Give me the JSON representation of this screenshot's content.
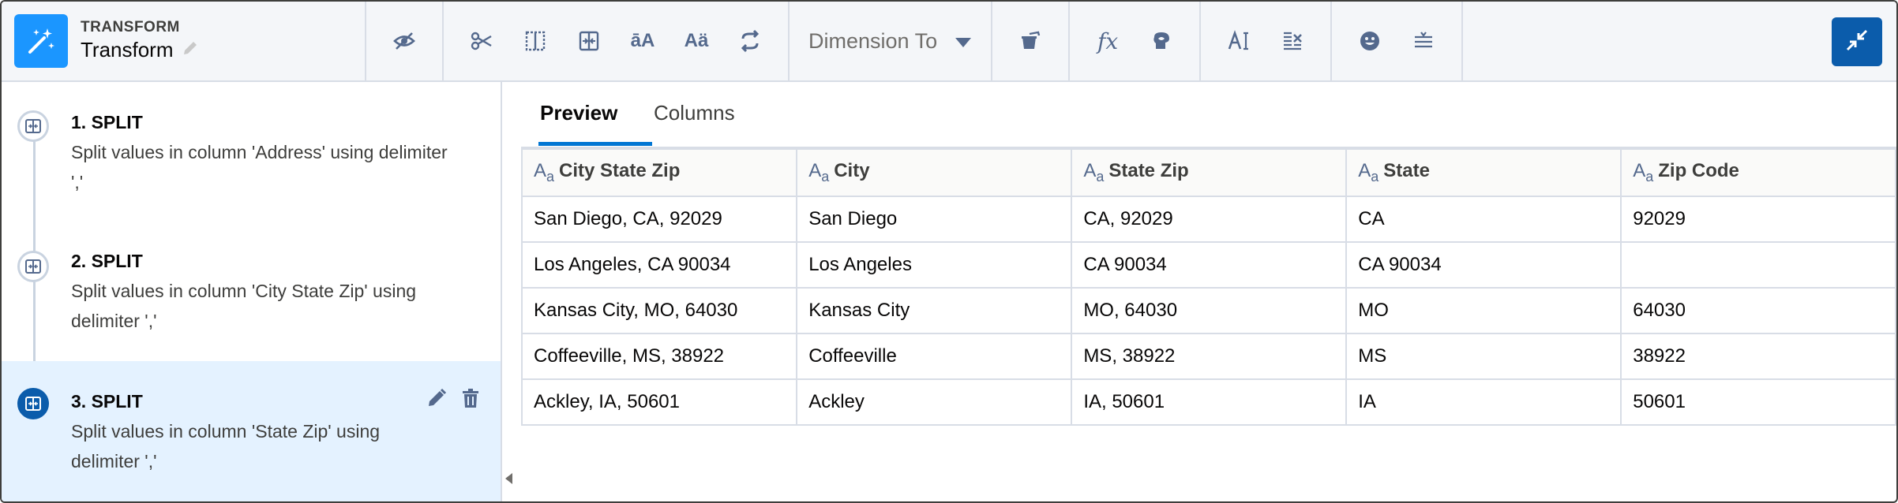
{
  "header": {
    "subtitle": "TRANSFORM",
    "title": "Transform"
  },
  "toolbar": {
    "dropdown_label": "Dimension To",
    "icons": [
      "hide-icon",
      "scissors-icon",
      "columns-icon",
      "split-icon",
      "case-icon",
      "accent-icon",
      "swap-icon",
      "dropdown-icon",
      "bucket-icon",
      "formula-icon",
      "predict-icon",
      "text-format-icon",
      "clear-column-icon",
      "sentiment-icon",
      "filter-list-icon",
      "collapse-icon"
    ],
    "accent_color": "#0b5cab"
  },
  "steps": [
    {
      "title": "1. SPLIT",
      "desc_line1": "Split values in column 'Address' using delimiter",
      "desc_line2": "','"
    },
    {
      "title": "2. SPLIT",
      "desc_line1": "Split values in column 'City State Zip' using",
      "desc_line2": "delimiter ','"
    },
    {
      "title": "3. SPLIT",
      "desc_line1": "Split values in column 'State Zip' using",
      "desc_line2": "delimiter ','"
    }
  ],
  "tabs": [
    {
      "label": "Preview"
    },
    {
      "label": "Columns"
    }
  ],
  "table": {
    "type_icon": "A",
    "type_icon_sub": "a",
    "columns": [
      "City State Zip",
      "City",
      "State Zip",
      "State",
      "Zip Code"
    ],
    "rows": [
      [
        "San Diego, CA, 92029",
        "San Diego",
        "CA, 92029",
        "CA",
        "92029"
      ],
      [
        "Los Angeles, CA 90034",
        "Los Angeles",
        "CA 90034",
        "CA 90034",
        ""
      ],
      [
        "Kansas City, MO, 64030",
        "Kansas City",
        "MO, 64030",
        "MO",
        "64030"
      ],
      [
        "Coffeeville, MS, 38922",
        "Coffeeville",
        "MS, 38922",
        "MS",
        "38922"
      ],
      [
        "Ackley, IA, 50601",
        "Ackley",
        "IA, 50601",
        "IA",
        "50601"
      ]
    ]
  }
}
